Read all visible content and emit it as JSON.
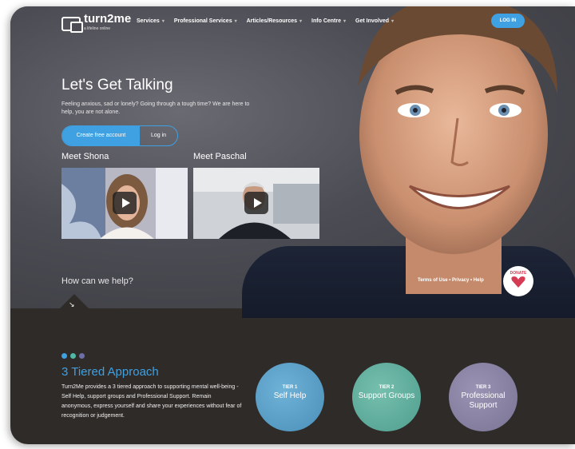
{
  "brand": {
    "name": "turn2me",
    "tagline": "a lifeline online"
  },
  "nav": {
    "items": [
      {
        "label": "Services"
      },
      {
        "label": "Professional Services"
      },
      {
        "label": "Articles/Resources"
      },
      {
        "label": "Info Centre"
      },
      {
        "label": "Get Involved"
      }
    ],
    "login_label": "LOG IN"
  },
  "hero": {
    "title": "Let's Get Talking",
    "subtitle": "Feeling anxious, sad or lonely? Going through a tough time? We are here to help, you are not alone.",
    "create_account": "Create free account",
    "login": "Log in"
  },
  "videos": [
    {
      "label": "Meet Shona"
    },
    {
      "label": "Meet Paschal"
    }
  ],
  "help": {
    "text": "How can we help?",
    "footer_links": "Terms of Use • Privacy • Help",
    "donate": "DONATE"
  },
  "approach": {
    "title": "3 Tiered Approach",
    "body": "Turn2Me provides a 3 tiered approach to supporting mental well-being - Self Help, support groups and Professional Support. Remain anonymous, express yourself and share your experiences without fear of recognition or judgement.",
    "dot_colors": [
      "#3fa0e2",
      "#4fb9a6",
      "#6c6fa8"
    ],
    "tiers": [
      {
        "label": "TIER 1",
        "name": "Self Help",
        "color": "#4a8fb8"
      },
      {
        "label": "TIER 2",
        "name": "Support Groups",
        "color": "#4f9e8e"
      },
      {
        "label": "TIER 3",
        "name": "Professional Support",
        "color": "#7a7494"
      }
    ]
  },
  "colors": {
    "accent": "#3fa0e2",
    "dark_bg": "#2f2b29"
  }
}
